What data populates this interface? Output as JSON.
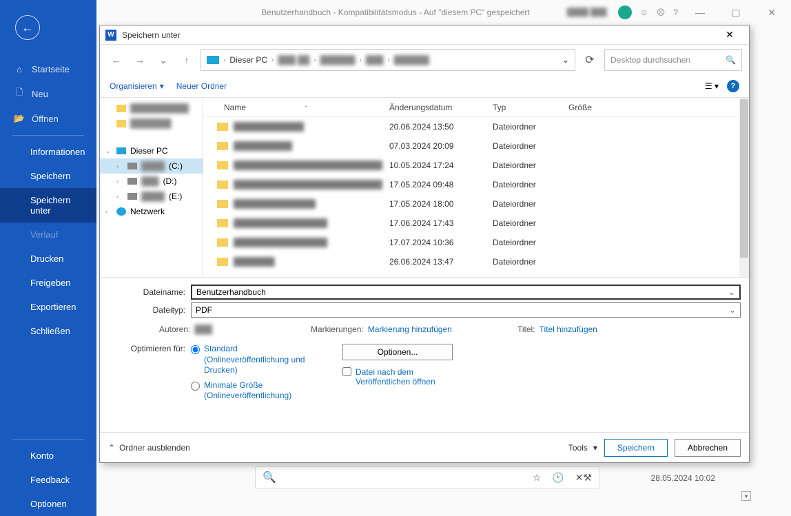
{
  "word_titlebar": {
    "title": "Benutzerhandbuch  -  Kompatibilitätsmodus  -  Auf \"diesem PC\" gespeichert",
    "user_blurred": "████ ███",
    "smile_icon": "☺",
    "frown_icon": "☹",
    "help": "?",
    "minimize": "—",
    "maximize": "▢",
    "close": "✕"
  },
  "sidebar": {
    "back": "←",
    "items_top": [
      {
        "icon": "⌂",
        "label": "Startseite"
      },
      {
        "icon": "🗋",
        "label": "Neu"
      },
      {
        "icon": "📂",
        "label": "Öffnen"
      }
    ],
    "items_mid": [
      {
        "label": "Informationen"
      },
      {
        "label": "Speichern"
      },
      {
        "label": "Speichern unter",
        "active": true
      },
      {
        "label": "Verlauf",
        "disabled": true
      },
      {
        "label": "Drucken"
      },
      {
        "label": "Freigeben"
      },
      {
        "label": "Exportieren"
      },
      {
        "label": "Schließen"
      }
    ],
    "items_bottom": [
      {
        "label": "Konto"
      },
      {
        "label": "Feedback"
      },
      {
        "label": "Optionen"
      }
    ]
  },
  "dialog": {
    "title": "Speichern unter",
    "nav": {
      "back": "←",
      "fwd": "→",
      "recent": "⌄",
      "up": "↑",
      "refresh": "⟳",
      "dropdown": "⌄"
    },
    "breadcrumb": {
      "sep": "›",
      "pc": "Dieser PC",
      "blur1": "███ ██",
      "blur2": "██████",
      "blur3": "███",
      "blur4": "██████"
    },
    "search_placeholder": "Desktop durchsuchen",
    "search_icon": "🔍",
    "toolbar": {
      "organize": "Organisieren",
      "caret": "▾",
      "new_folder": "Neuer Ordner",
      "view": "☰",
      "view_caret": "▾",
      "help": "?"
    },
    "columns": {
      "name": "Name",
      "date": "Änderungsdatum",
      "type": "Typ",
      "size": "Größe",
      "sort": "⌃"
    },
    "tree": {
      "blur_folder1": "██████████",
      "blur_folder2": "███████",
      "this_pc": "Dieser PC",
      "drive_c_blur": "████",
      "drive_c": "(C:)",
      "drive_d_blur": "███",
      "drive_d": "(D:)",
      "drive_e_blur": "████",
      "drive_e": "(E:)",
      "network": "Netzwerk",
      "exp_open": "⌄",
      "exp_closed": "›"
    },
    "files": [
      {
        "name": "████████████",
        "date": "20.06.2024 13:50",
        "type": "Dateiordner"
      },
      {
        "name": "██████████",
        "date": "07.03.2024 20:09",
        "type": "Dateiordner"
      },
      {
        "name": "███████████████████████████",
        "date": "10.05.2024 17:24",
        "type": "Dateiordner"
      },
      {
        "name": "██████████████████████████",
        "date": "17.05.2024 09:48",
        "type": "Dateiordner"
      },
      {
        "name": "██████████████",
        "date": "17.05.2024 18:00",
        "type": "Dateiordner"
      },
      {
        "name": "████████████████",
        "date": "17.06.2024 17:43",
        "type": "Dateiordner"
      },
      {
        "name": "████████████████",
        "date": "17.07.2024 10:36",
        "type": "Dateiordner"
      },
      {
        "name": "███████",
        "date": "26.06.2024 13:47",
        "type": "Dateiordner"
      }
    ],
    "filename_label": "Dateiname:",
    "filename_value": "Benutzerhandbuch",
    "filetype_label": "Dateityp:",
    "filetype_value": "PDF",
    "dd_caret": "⌄",
    "meta": {
      "authors_label": "Autoren:",
      "authors_value": "███",
      "tags_label": "Markierungen:",
      "tags_link": "Markierung hinzufügen",
      "title_label": "Titel:",
      "title_link": "Titel hinzufügen"
    },
    "optimize": {
      "label": "Optimieren für:",
      "standard": "Standard (Onlineveröffentlichung und Drucken)",
      "minimal": "Minimale Größe (Onlineveröffentlichung)",
      "options_button": "Optionen...",
      "checkbox_label": "Datei nach dem Veröffentlichen öffnen"
    },
    "footer": {
      "hide_folders_caret": "⌃",
      "hide_folders": "Ordner ausblenden",
      "tools": "Tools",
      "tools_caret": "▾",
      "save": "Speichern",
      "cancel": "Abbrechen"
    }
  },
  "status": {
    "search_icon": "🔍",
    "star": "☆",
    "clock": "🕑",
    "tools": "✕⚒",
    "timestamp": "28.05.2024 10:02",
    "scroll_down": "▾"
  }
}
